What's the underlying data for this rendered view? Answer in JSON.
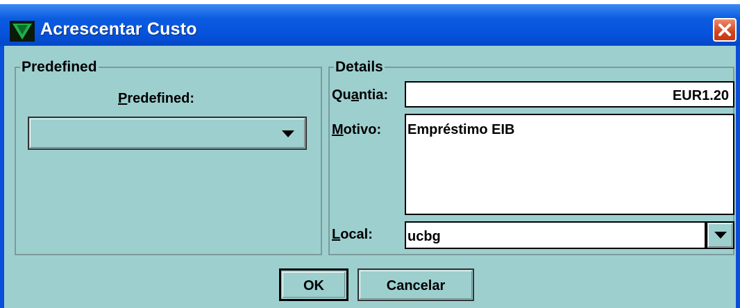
{
  "window": {
    "title": "Acrescentar Custo",
    "icon": "app-v-logo-icon",
    "close_icon": "close-icon"
  },
  "predefined_group": {
    "legend": "Predefined",
    "label": "Predefined:",
    "label_mnemonic": "P",
    "label_rest": "redefined:",
    "selected_value": ""
  },
  "details_group": {
    "legend": "Details",
    "quantia": {
      "label_pre": "Qu",
      "label_mnemonic": "a",
      "label_post": "ntia:",
      "value": "EUR1.20"
    },
    "motivo": {
      "label_mnemonic": "M",
      "label_rest": "otivo:",
      "value": "Empréstimo EIB"
    },
    "local": {
      "label_mnemonic": "L",
      "label_rest": "ocal:",
      "value": "ucbg"
    }
  },
  "buttons": {
    "ok": "OK",
    "cancel": "Cancelar"
  },
  "colors": {
    "titlebar": "#0653dd",
    "client_background": "#9ecfcf",
    "close_button": "#d2461e"
  }
}
